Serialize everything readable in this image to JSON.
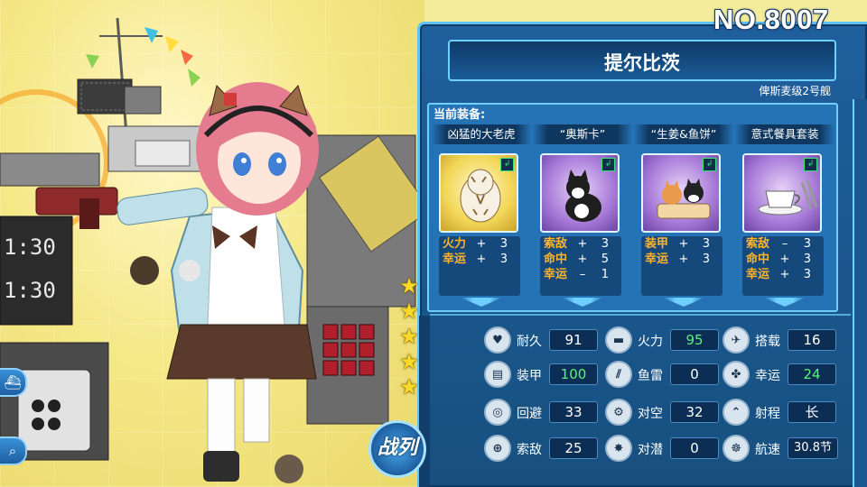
{
  "ship": {
    "number": "NO.8007",
    "name": "提尔比茨",
    "class": "俾斯麦级2号舰",
    "rarity_stars": 5
  },
  "equipment": {
    "title": "当前装备:",
    "slots": [
      {
        "name": "凶猛的大老虎",
        "frame": "gold",
        "icon": "tiger-icon",
        "stats": [
          {
            "k": "火力",
            "s": "+",
            "v": "3"
          },
          {
            "k": "幸运",
            "s": "+",
            "v": "3"
          }
        ]
      },
      {
        "name": "“奥斯卡”",
        "frame": "purple",
        "icon": "cat-icon",
        "stats": [
          {
            "k": "索敌",
            "s": "+",
            "v": "3"
          },
          {
            "k": "命中",
            "s": "+",
            "v": "5"
          },
          {
            "k": "幸运",
            "s": "–",
            "v": "1"
          }
        ]
      },
      {
        "name": "“生姜&鱼饼”",
        "frame": "purple",
        "icon": "two-cats-icon",
        "stats": [
          {
            "k": "装甲",
            "s": "+",
            "v": "3"
          },
          {
            "k": "幸运",
            "s": "+",
            "v": "3"
          }
        ]
      },
      {
        "name": "意式餐具套装",
        "frame": "purple",
        "icon": "teacup-icon",
        "stats": [
          {
            "k": "索敌",
            "s": "–",
            "v": "3"
          },
          {
            "k": "命中",
            "s": "+",
            "v": "3"
          },
          {
            "k": "幸运",
            "s": "+",
            "v": "3"
          }
        ]
      }
    ]
  },
  "stats": [
    {
      "label": "耐久",
      "value": "91",
      "highlight": false,
      "icon": "heart-shield-icon"
    },
    {
      "label": "火力",
      "value": "95",
      "highlight": true,
      "icon": "cannon-icon"
    },
    {
      "label": "搭载",
      "value": "16",
      "highlight": false,
      "icon": "plane-icon"
    },
    {
      "label": "装甲",
      "value": "100",
      "highlight": true,
      "icon": "armor-icon"
    },
    {
      "label": "鱼雷",
      "value": "0",
      "highlight": false,
      "icon": "torpedo-icon"
    },
    {
      "label": "幸运",
      "value": "24",
      "highlight": true,
      "icon": "clover-icon"
    },
    {
      "label": "回避",
      "value": "33",
      "highlight": false,
      "icon": "evasion-icon"
    },
    {
      "label": "对空",
      "value": "32",
      "highlight": false,
      "icon": "anti-air-icon"
    },
    {
      "label": "射程",
      "value": "长",
      "highlight": false,
      "icon": "range-icon"
    },
    {
      "label": "索敌",
      "value": "25",
      "highlight": false,
      "icon": "radar-icon"
    },
    {
      "label": "对潜",
      "value": "0",
      "highlight": false,
      "icon": "depth-charge-icon"
    },
    {
      "label": "航速",
      "value": "30.8节",
      "highlight": false,
      "icon": "speed-icon"
    }
  ],
  "buttons": {
    "battle": "战列"
  },
  "art": {
    "screen_left_top": "1:30",
    "screen_left_bottom": "1:30"
  },
  "colors": {
    "panel": "#1f5f9d",
    "frame": "#6fd0ff",
    "stat_label": "#ffb52e",
    "highlight_value": "#5cf07a"
  }
}
